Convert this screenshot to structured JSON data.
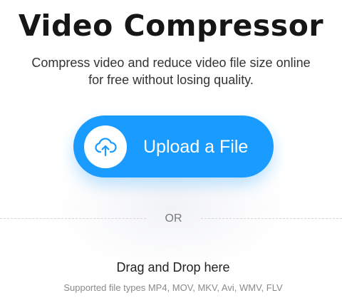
{
  "header": {
    "title": "Video Compressor",
    "subtitle": "Compress video and reduce video file size online for free without losing quality."
  },
  "upload": {
    "button_label": "Upload a File",
    "icon": "cloud-upload-icon",
    "accent_color": "#1a9bff"
  },
  "separator": {
    "or_text": "OR"
  },
  "dropzone": {
    "label": "Drag and Drop here",
    "supported_types": "Supported file types MP4, MOV, MKV, Avi, WMV, FLV"
  }
}
